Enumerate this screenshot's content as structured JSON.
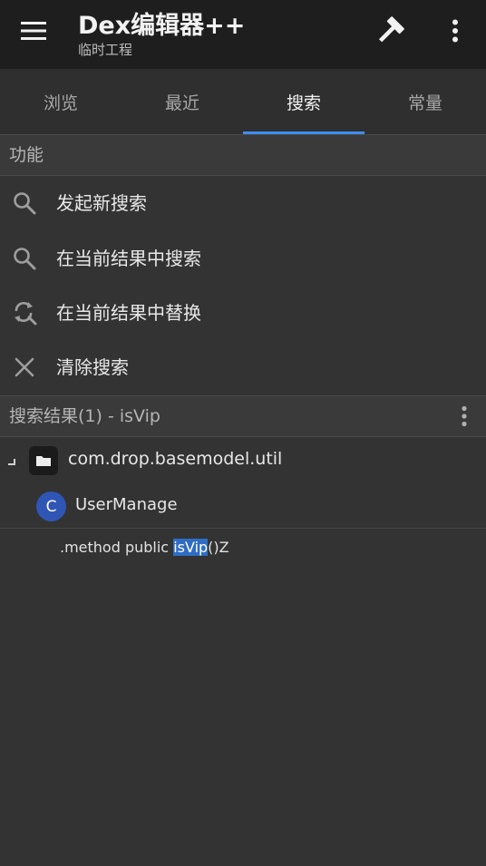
{
  "app": {
    "title": "Dex编辑器++",
    "subtitle": "临时工程"
  },
  "toolbar": {
    "menu_icon": "hamburger-menu-icon",
    "build_icon": "hammer-icon",
    "overflow_icon": "more-vertical-icon"
  },
  "tabs": [
    {
      "label": "浏览",
      "active": false
    },
    {
      "label": "最近",
      "active": false
    },
    {
      "label": "搜索",
      "active": true
    },
    {
      "label": "常量",
      "active": false
    }
  ],
  "functions": {
    "header": "功能",
    "items": [
      {
        "label": "发起新搜索",
        "icon": "search-icon"
      },
      {
        "label": "在当前结果中搜索",
        "icon": "search-icon"
      },
      {
        "label": "在当前结果中替换",
        "icon": "replace-icon"
      },
      {
        "label": "清除搜索",
        "icon": "close-icon"
      }
    ]
  },
  "results": {
    "header": "搜索结果(1) - isVip",
    "package": "com.drop.basemodel.util",
    "class_badge": "C",
    "class_name": "UserManage",
    "match_prefix": ".method public ",
    "match_highlight": "isVip",
    "match_suffix": "()Z"
  },
  "colors": {
    "accent": "#3f8ef0",
    "class_badge": "#2f55b5",
    "highlight": "#2f6dc4"
  }
}
